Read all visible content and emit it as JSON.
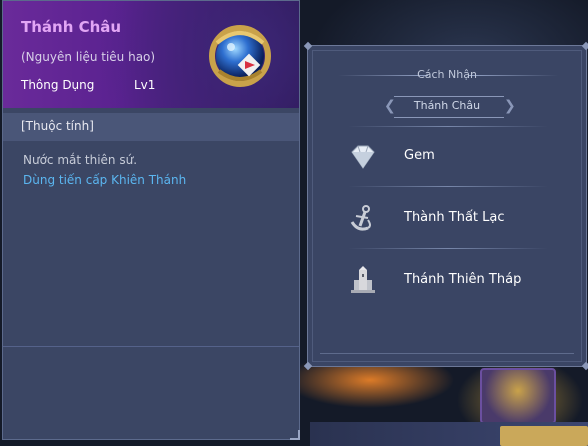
{
  "item": {
    "name": "Thánh Châu",
    "subtitle": "(Nguyên liệu tiêu hao)",
    "rarity": "Thông Dụng",
    "level": "Lv1",
    "icon": "orb-icon",
    "section_title": "[Thuộc tính]",
    "description": "Nước mắt thiên sứ.",
    "usage": "Dùng tiến cấp Khiên Thánh"
  },
  "acquire": {
    "title": "Cách Nhận",
    "subtitle": "Thánh Châu",
    "sources": [
      {
        "label": "Gem",
        "icon": "gem-icon"
      },
      {
        "label": "Thành Thất Lạc",
        "icon": "anchor-icon"
      },
      {
        "label": "Thánh Thiên Tháp",
        "icon": "tower-icon"
      }
    ]
  },
  "colors": {
    "item_name": "#e2a6f5",
    "usage_link": "#5bb6f0",
    "panel_bg": "#3b4664",
    "header_purple": "#6a2a9a"
  }
}
